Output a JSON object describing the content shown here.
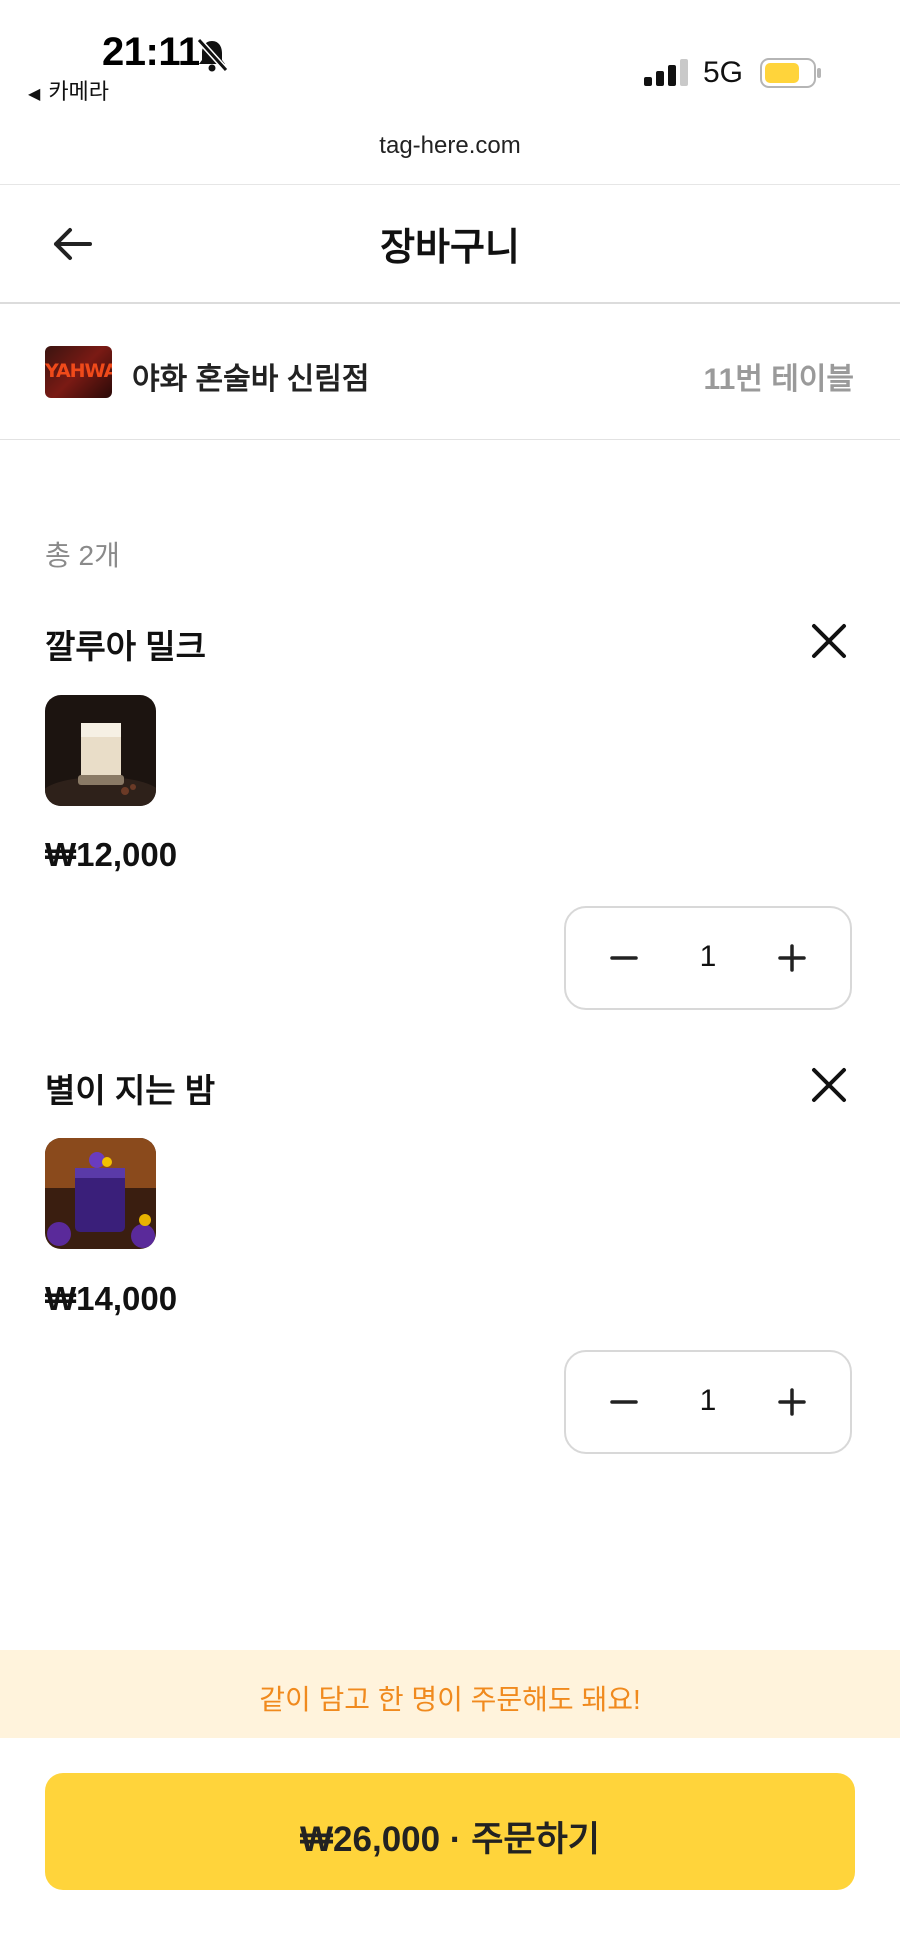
{
  "status_bar": {
    "time": "21:11",
    "back_app": "카메라",
    "network": "5G",
    "battery_color": "#ffd43b"
  },
  "browser": {
    "url": "tag-here.com"
  },
  "header": {
    "title": "장바구니",
    "back_icon": "arrow-left-icon"
  },
  "store": {
    "logo_text": "YAHWA",
    "name": "야화 혼술바 신림점",
    "table": "11번 테이블"
  },
  "cart": {
    "total_label": "총 2개",
    "items": [
      {
        "name": "깔루아 밀크",
        "price": "₩12,000",
        "quantity": "1"
      },
      {
        "name": "별이 지는 밤",
        "price": "₩14,000",
        "quantity": "1"
      }
    ]
  },
  "promo": {
    "text": "같이 담고 한 명이 주문해도 돼요!"
  },
  "order": {
    "label": "₩26,000 · 주문하기"
  },
  "colors": {
    "accent": "#ffd43b",
    "promo_text": "#f08a1e",
    "promo_bg": "#fff3dc"
  }
}
